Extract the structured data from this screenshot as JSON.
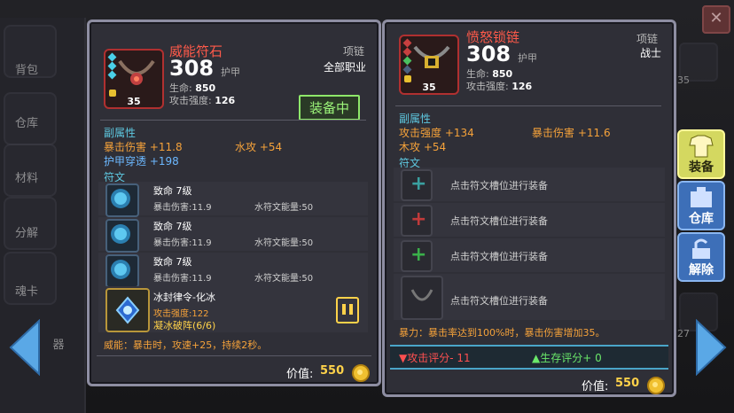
{
  "sidebar": {
    "items": [
      {
        "label": "背包"
      },
      {
        "label": "仓库"
      },
      {
        "label": "材料"
      },
      {
        "label": "分解"
      },
      {
        "label": "魂卡"
      },
      {
        "label": "器"
      }
    ]
  },
  "background_numbers": {
    "level_a": "35",
    "level_b": "27"
  },
  "left_panel": {
    "name": "威能符石",
    "type": "项链",
    "classes": "全部职业",
    "level": "35",
    "armor_value": "308",
    "armor_label": "护甲",
    "hp_label": "生命:",
    "hp_value": "850",
    "atk_label": "攻击强度:",
    "atk_value": "126",
    "equipped_label": "装备中",
    "sub_attr_title": "副属性",
    "sub_attrs": [
      {
        "text": "暴击伤害 +11.8"
      },
      {
        "text": "水攻 +54"
      },
      {
        "text": "护甲穿透 +198"
      }
    ],
    "rune_title": "符文",
    "runes": [
      {
        "name": "致命 7级",
        "stat1": "暴击伤害:11.9",
        "stat2": "水符文能量:50"
      },
      {
        "name": "致命 7级",
        "stat1": "暴击伤害:11.9",
        "stat2": "水符文能量:50"
      },
      {
        "name": "致命 7级",
        "stat1": "暴击伤害:11.9",
        "stat2": "水符文能量:50"
      }
    ],
    "special_rune": {
      "name": "冰封律令-化冰",
      "stat": "攻击强度:122",
      "effect": "凝冰破阵(6/6)"
    },
    "special_text": "威能：暴击时，攻速+25，持续2秒。",
    "value_label": "价值:",
    "value": "550"
  },
  "right_panel": {
    "name": "愤怒锁链",
    "type": "项链",
    "classes": "战士",
    "level": "35",
    "armor_value": "308",
    "armor_label": "护甲",
    "hp_label": "生命:",
    "hp_value": "850",
    "atk_label": "攻击强度:",
    "atk_value": "126",
    "sub_attr_title": "副属性",
    "sub_attrs": [
      {
        "text": "攻击强度 +134"
      },
      {
        "text": "暴击伤害 +11.6"
      },
      {
        "text": "木攻 +54"
      }
    ],
    "rune_title": "符文",
    "empty_slot_text": "点击符文槽位进行装备",
    "special_text": "暴力：暴击率达到100%时，暴击伤害增加35。",
    "attack_score": "攻击评分- 11",
    "survive_score": "生存评分+ 0",
    "value_label": "价值:",
    "value": "550"
  },
  "tabs": [
    {
      "label": "装备"
    },
    {
      "label": "仓库"
    },
    {
      "label": "解除"
    }
  ],
  "colors": {
    "legendary_red": "#ff5a4a",
    "attr_orange": "#f5a23a",
    "attr_blue": "#6cb8ff",
    "section_cyan": "#5ec8e0",
    "equipped_green": "#9cf57a",
    "gold": "#ffd24a",
    "panel_border": "#8e8ea2"
  },
  "icons": {
    "close": "close-icon",
    "coin": "coin-icon",
    "arrow_left": "arrow-left-icon",
    "arrow_right": "arrow-right-icon"
  }
}
